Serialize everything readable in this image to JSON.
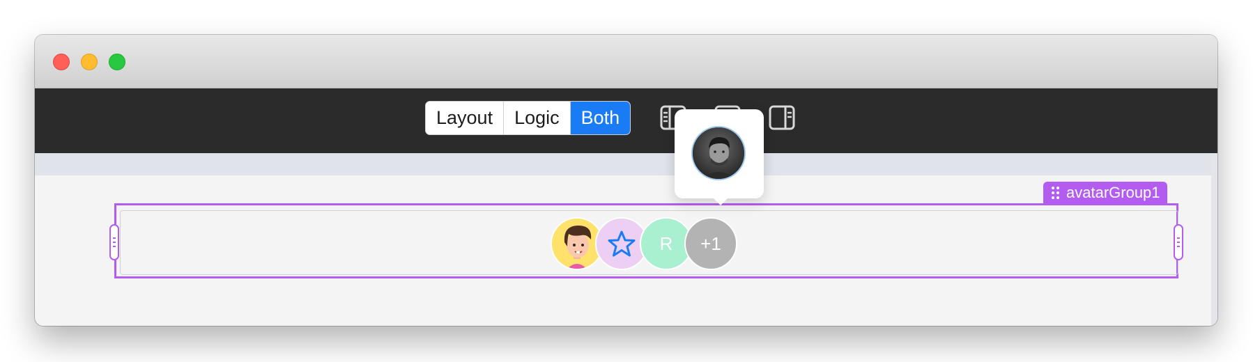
{
  "window": {
    "controls": [
      "close",
      "minimize",
      "maximize"
    ]
  },
  "toolbar": {
    "view_modes": [
      {
        "label": "Layout",
        "active": false
      },
      {
        "label": "Logic",
        "active": false
      },
      {
        "label": "Both",
        "active": true
      }
    ],
    "panel_icons": [
      "left-panel-icon",
      "bottom-panel-icon",
      "right-panel-icon"
    ],
    "active_color": "#1a7cf5"
  },
  "selection": {
    "component_name": "avatarGroup1",
    "color": "#b35cf0"
  },
  "avatar_group": {
    "avatars": [
      {
        "type": "illustration",
        "name": "cartoon-boy-avatar",
        "bg": "#ffe26b"
      },
      {
        "type": "icon",
        "name": "star-icon",
        "bg": "#eccff3"
      },
      {
        "type": "initial",
        "text": "R",
        "bg": "#a9f0d1"
      },
      {
        "type": "overflow",
        "text": "+1",
        "bg": "#b3b3b3"
      }
    ]
  },
  "popover": {
    "avatar": "photo-avatar"
  }
}
